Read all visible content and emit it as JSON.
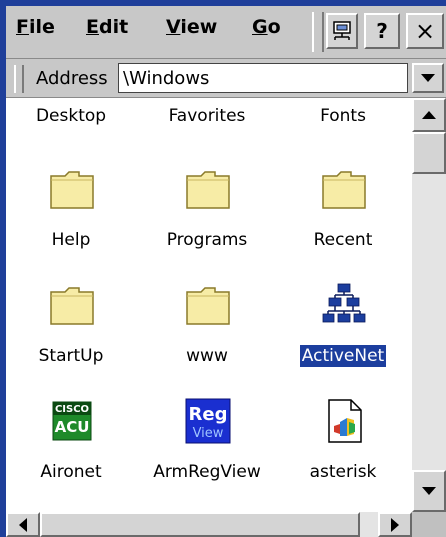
{
  "menubar": {
    "file": {
      "prefix": "",
      "ul": "F",
      "rest": "ile"
    },
    "edit": {
      "prefix": "",
      "ul": "E",
      "rest": "dit"
    },
    "view": {
      "prefix": "",
      "ul": "V",
      "rest": "iew"
    },
    "go": {
      "prefix": "",
      "ul": "G",
      "rest": "o"
    },
    "help_label": "?",
    "close_label": "×"
  },
  "address": {
    "label": "Address",
    "value": "\\Windows"
  },
  "top_row": [
    "Desktop",
    "Favorites",
    "Fonts"
  ],
  "items": [
    {
      "label": "Help",
      "icon": "folder-icon"
    },
    {
      "label": "Programs",
      "icon": "folder-icon"
    },
    {
      "label": "Recent",
      "icon": "folder-icon"
    },
    {
      "label": "StartUp",
      "icon": "folder-icon"
    },
    {
      "label": "www",
      "icon": "folder-icon"
    },
    {
      "label": "ActiveNet",
      "icon": "network-icon",
      "selected": true
    },
    {
      "label": "Aironet",
      "icon": "cisco-acu-icon",
      "icon_text_1": "CISCO",
      "icon_text_2": "ACU"
    },
    {
      "label": "ArmRegView",
      "icon": "regview-icon",
      "icon_text_1": "Reg",
      "icon_text_2": "View"
    },
    {
      "label": "asterisk",
      "icon": "sound-file-icon"
    }
  ],
  "colors": {
    "selection": "#1c3e9e",
    "folder_fill": "#f7eca6",
    "frame": "#1f3f9a"
  }
}
